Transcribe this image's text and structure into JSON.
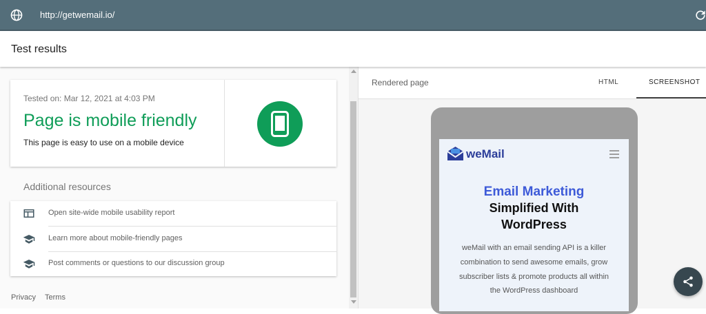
{
  "browser": {
    "url": "http://getwemail.io/"
  },
  "header": {
    "title": "Test results"
  },
  "result": {
    "tested_on": "Tested on: Mar 12, 2021 at 4:03 PM",
    "verdict": "Page is mobile friendly",
    "description": "This page is easy to use on a mobile device",
    "verdict_color": "#0f9d58"
  },
  "resources": {
    "heading": "Additional resources",
    "items": [
      {
        "icon": "web-page-icon",
        "label": "Open site-wide mobile usability report"
      },
      {
        "icon": "school-icon",
        "label": "Learn more about mobile-friendly pages"
      },
      {
        "icon": "school-icon",
        "label": "Post comments or questions to our discussion group"
      }
    ]
  },
  "footer": {
    "privacy": "Privacy",
    "terms": "Terms"
  },
  "panel": {
    "label": "Rendered page",
    "tabs": [
      {
        "label": "HTML",
        "active": false
      },
      {
        "label": "SCREENSHOT",
        "active": true
      }
    ]
  },
  "preview": {
    "logo": "weMail",
    "headline_1": "Email Marketing",
    "headline_2": "Simplified With",
    "headline_3": "WordPress",
    "body_lines": [
      "weMail with an email sending API is a killer",
      "combination to send awesome emails, grow",
      "subscriber lists & promote products all within",
      "the WordPress dashboard"
    ]
  }
}
